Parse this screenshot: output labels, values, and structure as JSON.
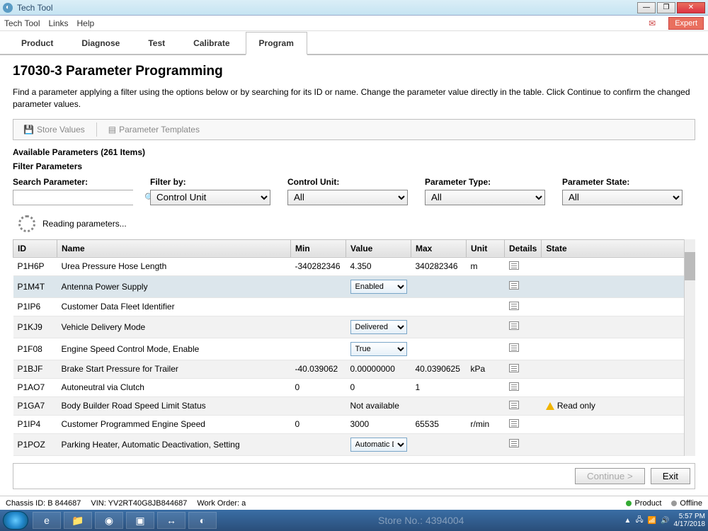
{
  "window": {
    "title": "Tech Tool",
    "expert": "Expert"
  },
  "menu": [
    "Tech Tool",
    "Links",
    "Help"
  ],
  "tabs": [
    {
      "label": "Product"
    },
    {
      "label": "Diagnose"
    },
    {
      "label": "Test"
    },
    {
      "label": "Calibrate"
    },
    {
      "label": "Program",
      "active": true
    }
  ],
  "page": {
    "title": "17030-3 Parameter Programming",
    "desc": "Find a parameter applying a filter using the options below or by searching for its ID or name. Change the parameter value directly in the table. Click Continue to confirm the changed parameter values.",
    "store_values": "Store Values",
    "param_templates": "Parameter Templates",
    "available_label": "Available Parameters (261 Items)",
    "filter_label": "Filter Parameters",
    "loading": "Reading parameters..."
  },
  "filters": {
    "search_label": "Search Parameter:",
    "filter_by_label": "Filter by:",
    "filter_by_value": "Control Unit",
    "control_unit_label": "Control Unit:",
    "control_unit_value": "All",
    "param_type_label": "Parameter Type:",
    "param_type_value": "All",
    "param_state_label": "Parameter State:",
    "param_state_value": "All"
  },
  "columns": [
    "ID",
    "Name",
    "Min",
    "Value",
    "Max",
    "Unit",
    "Details",
    "State"
  ],
  "rows": [
    {
      "id": "P1H6P",
      "name": "Urea Pressure Hose Length",
      "min": "-340282346",
      "value": "4.350",
      "max": "340282346",
      "unit": "m",
      "state": ""
    },
    {
      "id": "P1M4T",
      "name": "Antenna Power Supply",
      "min": "",
      "value_dd": "Enabled",
      "max": "",
      "unit": "",
      "state": "",
      "selected": true
    },
    {
      "id": "P1IP6",
      "name": "Customer Data Fleet Identifier",
      "min": "",
      "value": "",
      "max": "",
      "unit": "",
      "state": ""
    },
    {
      "id": "P1KJ9",
      "name": "Vehicle Delivery Mode",
      "min": "",
      "value_dd": "Delivered",
      "max": "",
      "unit": "",
      "state": ""
    },
    {
      "id": "P1F08",
      "name": "Engine Speed Control Mode, Enable",
      "min": "",
      "value_dd": "True",
      "max": "",
      "unit": "",
      "state": ""
    },
    {
      "id": "P1BJF",
      "name": "Brake Start Pressure for Trailer",
      "min": "-40.039062",
      "value": "0.00000000",
      "max": "40.0390625",
      "unit": "kPa",
      "state": ""
    },
    {
      "id": "P1AO7",
      "name": "Autoneutral via Clutch",
      "min": "0",
      "value": "0",
      "max": "1",
      "unit": "",
      "state": ""
    },
    {
      "id": "P1GA7",
      "name": "Body Builder Road Speed Limit Status",
      "min": "",
      "value": "Not available",
      "max": "",
      "unit": "",
      "state": "Read only",
      "warn": true
    },
    {
      "id": "P1IP4",
      "name": "Customer Programmed Engine Speed",
      "min": "0",
      "value": "3000",
      "max": "65535",
      "unit": "r/min",
      "state": ""
    },
    {
      "id": "P1POZ",
      "name": "Parking Heater, Automatic Deactivation, Setting",
      "min": "",
      "value_dd": "Automatic D",
      "max": "",
      "unit": "",
      "state": ""
    }
  ],
  "buttons": {
    "continue": "Continue >",
    "exit": "Exit"
  },
  "status": {
    "chassis": "Chassis ID: B 844687",
    "vin": "VIN: YV2RT40G8JB844687",
    "work": "Work Order: a",
    "product": "Product",
    "offline": "Offline"
  },
  "watermark": "Store No.: 4394004",
  "taskbar": {
    "time": "5:57 PM",
    "date": "4/17/2018"
  }
}
